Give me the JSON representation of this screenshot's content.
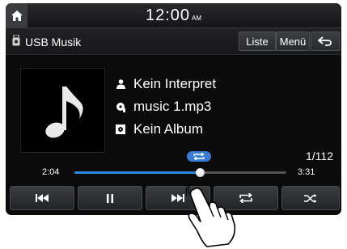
{
  "status": {
    "time": "12:00",
    "ampm": "AM"
  },
  "header": {
    "source": "USB Musik",
    "list_label": "Liste",
    "menu_label": "Menü"
  },
  "track": {
    "artist": "Kein Interpret",
    "file": "music 1.mp3",
    "album": "Kein Album",
    "counter": "1/112",
    "elapsed": "2:04",
    "duration": "3:31",
    "progress_fraction": 0.59
  },
  "colors": {
    "accent": "#2f8ae6",
    "badge": "#3a7bd5"
  },
  "icons": {
    "home": "home-icon",
    "usb": "usb-icon",
    "back": "back-icon",
    "artist": "artist-icon",
    "file": "file-icon",
    "album": "album-icon",
    "repeat_status": "repeat-icon",
    "prev": "previous-track-icon",
    "pause": "pause-icon",
    "next": "next-track-icon",
    "repeat": "repeat-icon",
    "shuffle": "shuffle-icon",
    "cover": "music-note-icon",
    "hand": "hand-pointer-icon"
  }
}
